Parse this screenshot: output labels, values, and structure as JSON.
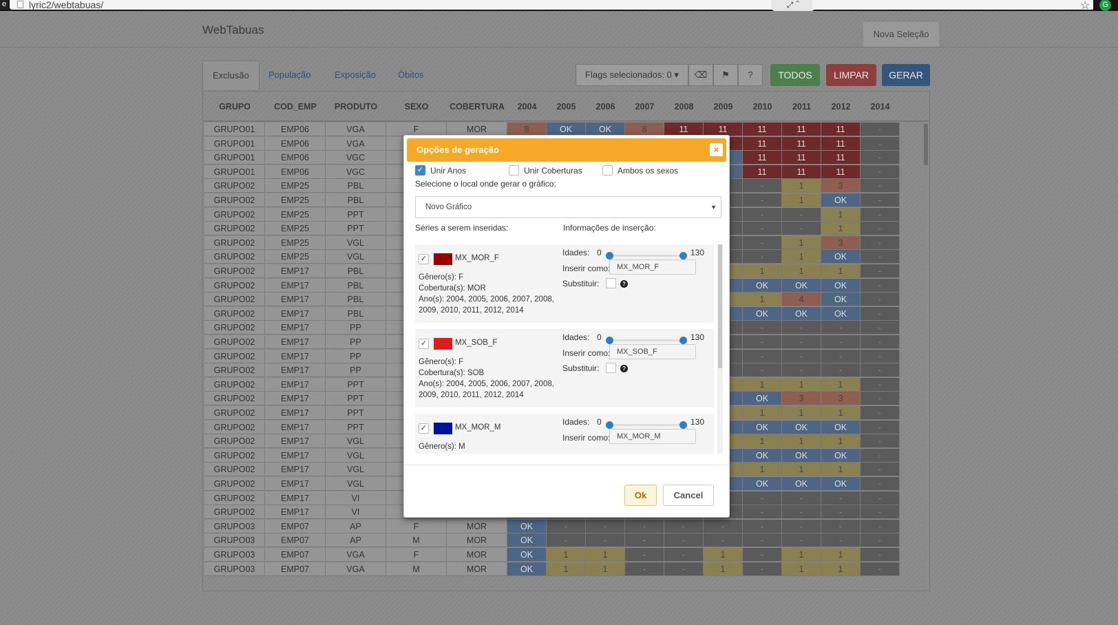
{
  "browser": {
    "url": "lyric2/webtabuas/"
  },
  "app": {
    "brand": "WebTabuas",
    "nav_right": "Nova Seleção"
  },
  "tabs": [
    {
      "label": "Exclusão"
    },
    {
      "label": "População"
    },
    {
      "label": "Exposição"
    },
    {
      "label": "Óbitos"
    }
  ],
  "toolbar": {
    "flags_label": "Flags selecionados: 0",
    "todos": "TODOS",
    "limpar": "LIMPAR",
    "gerar": "GERAR"
  },
  "table": {
    "headers": [
      "GRUPO",
      "COD_EMP",
      "PRODUTO",
      "SEXO",
      "COBERTURA",
      "2004",
      "2005",
      "2006",
      "2007",
      "2008",
      "2009",
      "2010",
      "2011",
      "2012",
      "2014"
    ],
    "rows": [
      [
        "GRUPO01",
        "EMP06",
        "VGA",
        "F",
        "MOR",
        "8",
        "OK",
        "OK",
        "8",
        "11",
        "11",
        "11",
        "11",
        "11",
        "-"
      ],
      [
        "GRUPO01",
        "EMP06",
        "VGA",
        "",
        "",
        "",
        "",
        "",
        "",
        "",
        "11",
        "11",
        "11",
        "11",
        "-"
      ],
      [
        "GRUPO01",
        "EMP06",
        "VGC",
        "",
        "",
        "",
        "",
        "",
        "",
        "",
        "OK",
        "11",
        "11",
        "11",
        "-"
      ],
      [
        "GRUPO01",
        "EMP06",
        "VGC",
        "",
        "",
        "",
        "",
        "",
        "",
        "",
        "OK",
        "11",
        "11",
        "11",
        "-"
      ],
      [
        "GRUPO02",
        "EMP25",
        "PBL",
        "",
        "",
        "",
        "",
        "",
        "",
        "",
        "-",
        "-",
        "1",
        "3",
        "-"
      ],
      [
        "GRUPO02",
        "EMP25",
        "PBL",
        "",
        "",
        "",
        "",
        "",
        "",
        "",
        "-",
        "-",
        "1",
        "OK",
        "-"
      ],
      [
        "GRUPO02",
        "EMP25",
        "PPT",
        "",
        "",
        "",
        "",
        "",
        "",
        "",
        "-",
        "-",
        "-",
        "1",
        "-"
      ],
      [
        "GRUPO02",
        "EMP25",
        "PPT",
        "",
        "",
        "",
        "",
        "",
        "",
        "",
        "-",
        "-",
        "-",
        "1",
        "-"
      ],
      [
        "GRUPO02",
        "EMP25",
        "VGL",
        "",
        "",
        "",
        "",
        "",
        "",
        "",
        "-",
        "-",
        "1",
        "3",
        "-"
      ],
      [
        "GRUPO02",
        "EMP25",
        "VGL",
        "",
        "",
        "",
        "",
        "",
        "",
        "",
        "-",
        "-",
        "1",
        "OK",
        "-"
      ],
      [
        "GRUPO02",
        "EMP17",
        "PBL",
        "",
        "",
        "",
        "",
        "",
        "",
        "",
        "1",
        "1",
        "1",
        "1",
        "-"
      ],
      [
        "GRUPO02",
        "EMP17",
        "PBL",
        "",
        "",
        "",
        "",
        "",
        "",
        "",
        "OK",
        "OK",
        "OK",
        "OK",
        "-"
      ],
      [
        "GRUPO02",
        "EMP17",
        "PBL",
        "",
        "",
        "",
        "",
        "",
        "",
        "",
        "1",
        "1",
        "4",
        "OK",
        "-"
      ],
      [
        "GRUPO02",
        "EMP17",
        "PBL",
        "",
        "",
        "",
        "",
        "",
        "",
        "",
        "OK",
        "OK",
        "OK",
        "OK",
        "-"
      ],
      [
        "GRUPO02",
        "EMP17",
        "PP",
        "",
        "",
        "",
        "",
        "",
        "",
        "",
        "-",
        "-",
        "-",
        "-",
        "-"
      ],
      [
        "GRUPO02",
        "EMP17",
        "PP",
        "",
        "",
        "",
        "",
        "",
        "",
        "",
        "-",
        "-",
        "-",
        "-",
        "-"
      ],
      [
        "GRUPO02",
        "EMP17",
        "PP",
        "",
        "",
        "",
        "",
        "",
        "",
        "",
        "-",
        "-",
        "-",
        "-",
        "-"
      ],
      [
        "GRUPO02",
        "EMP17",
        "PP",
        "",
        "",
        "",
        "",
        "",
        "",
        "",
        "-",
        "-",
        "-",
        "-",
        "-"
      ],
      [
        "GRUPO02",
        "EMP17",
        "PPT",
        "",
        "",
        "",
        "",
        "",
        "",
        "",
        "1",
        "1",
        "1",
        "1",
        "-"
      ],
      [
        "GRUPO02",
        "EMP17",
        "PPT",
        "",
        "",
        "",
        "",
        "",
        "",
        "",
        "OK",
        "OK",
        "3",
        "3",
        "-"
      ],
      [
        "GRUPO02",
        "EMP17",
        "PPT",
        "",
        "",
        "",
        "",
        "",
        "",
        "",
        "1",
        "1",
        "1",
        "1",
        "-"
      ],
      [
        "GRUPO02",
        "EMP17",
        "PPT",
        "",
        "",
        "",
        "",
        "",
        "",
        "",
        "OK",
        "OK",
        "OK",
        "OK",
        "-"
      ],
      [
        "GRUPO02",
        "EMP17",
        "VGL",
        "",
        "",
        "",
        "",
        "",
        "",
        "",
        "1",
        "1",
        "1",
        "1",
        "-"
      ],
      [
        "GRUPO02",
        "EMP17",
        "VGL",
        "",
        "",
        "",
        "",
        "",
        "",
        "",
        "OK",
        "OK",
        "OK",
        "OK",
        "-"
      ],
      [
        "GRUPO02",
        "EMP17",
        "VGL",
        "",
        "",
        "",
        "",
        "",
        "",
        "",
        "1",
        "1",
        "1",
        "1",
        "-"
      ],
      [
        "GRUPO02",
        "EMP17",
        "VGL",
        "",
        "",
        "",
        "",
        "",
        "",
        "",
        "OK",
        "OK",
        "OK",
        "OK",
        "-"
      ],
      [
        "GRUPO02",
        "EMP17",
        "VI",
        "",
        "",
        "",
        "",
        "",
        "",
        "",
        "-",
        "-",
        "-",
        "-",
        "-"
      ],
      [
        "GRUPO02",
        "EMP17",
        "VI",
        "M",
        "SOB",
        "OK",
        "-",
        "-",
        "-",
        "-",
        "-",
        "-",
        "-",
        "-",
        "-"
      ],
      [
        "GRUPO03",
        "EMP07",
        "AP",
        "F",
        "MOR",
        "OK",
        "-",
        "-",
        "-",
        "-",
        "-",
        "-",
        "-",
        "-",
        "-"
      ],
      [
        "GRUPO03",
        "EMP07",
        "AP",
        "M",
        "MOR",
        "OK",
        "-",
        "-",
        "-",
        "-",
        "-",
        "-",
        "-",
        "-",
        "-"
      ],
      [
        "GRUPO03",
        "EMP07",
        "VGA",
        "F",
        "MOR",
        "OK",
        "1",
        "1",
        "-",
        "-",
        "1",
        "-",
        "1",
        "1",
        "-"
      ],
      [
        "GRUPO03",
        "EMP07",
        "VGA",
        "M",
        "MOR",
        "OK",
        "1",
        "1",
        "-",
        "-",
        "1",
        "-",
        "1",
        "1",
        "-"
      ]
    ]
  },
  "modal": {
    "title": "Opções de geração",
    "close": "×",
    "options": [
      {
        "label": "Unir Anos",
        "checked": true
      },
      {
        "label": "Unir Coberturas",
        "checked": false
      },
      {
        "label": "Ambos os sexos",
        "checked": false
      }
    ],
    "select_label": "Selecione o local onde gerar o gráfico:",
    "select_value": "Novo Gráfico",
    "series_header": "Séries a serem inseridas:",
    "info_header": "Informações de inserção:",
    "series": [
      {
        "name": "MX_MOR_F",
        "color": "#990000",
        "genero": "Gênero(s): F",
        "cobertura": "Cobertura(s): MOR",
        "anos1": "Ano(s): 2004, 2005, 2006, 2007, 2008,",
        "anos2": "2009, 2010, 2011, 2012, 2014",
        "idades_label": "Idades:",
        "min": "0",
        "max": "130",
        "inserir_label": "Inserir como:",
        "inserir_value": "MX_MOR_F",
        "substituir_label": "Substituir:"
      },
      {
        "name": "MX_SOB_F",
        "color": "#e01b1b",
        "genero": "Gênero(s): F",
        "cobertura": "Cobertura(s): SOB",
        "anos1": "Ano(s): 2004, 2005, 2006, 2007, 2008,",
        "anos2": "2009, 2010, 2011, 2012, 2014",
        "idades_label": "Idades:",
        "min": "0",
        "max": "130",
        "inserir_label": "Inserir como:",
        "inserir_value": "MX_SOB_F",
        "substituir_label": "Substituir:"
      },
      {
        "name": "MX_MOR_M",
        "color": "#00139c",
        "genero": "Gênero(s): M",
        "cobertura": "",
        "anos1": "",
        "anos2": "",
        "idades_label": "Idades:",
        "min": "0",
        "max": "130",
        "inserir_label": "Inserir como:",
        "inserir_value": "MX_MOR_M",
        "substituir_label": ""
      }
    ],
    "ok": "Ok",
    "cancel": "Cancel"
  }
}
